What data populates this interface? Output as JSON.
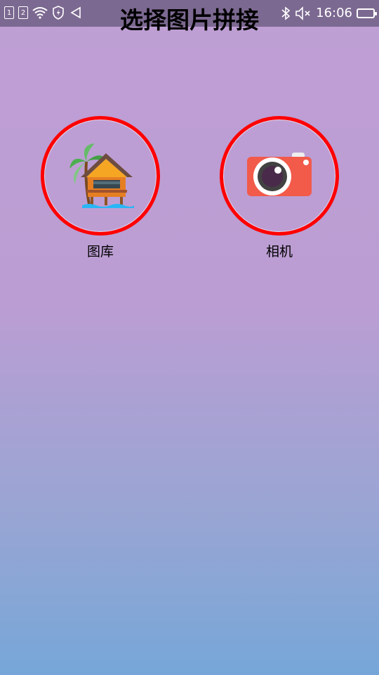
{
  "status_bar": {
    "sim1": "1",
    "sim2": "2",
    "time": "16:06"
  },
  "header": {
    "title": "选择图片拼接"
  },
  "options": [
    {
      "label": "图库",
      "icon": "hut-gallery-icon"
    },
    {
      "label": "相机",
      "icon": "camera-icon"
    }
  ],
  "colors": {
    "ring": "#ff0000",
    "camera_body": "#f25a4a"
  }
}
